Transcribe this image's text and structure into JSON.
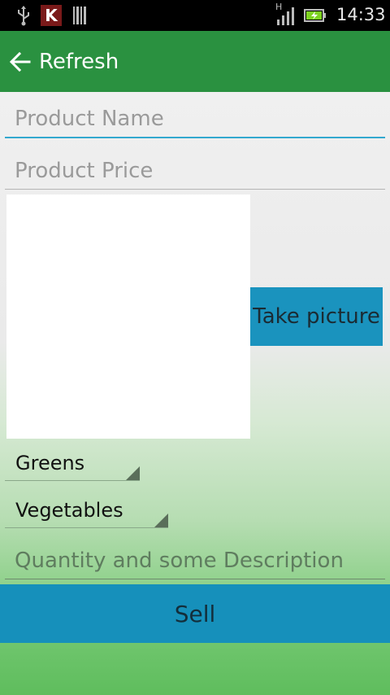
{
  "status_bar": {
    "time": "14:33",
    "network_type": "H",
    "k_app_letter": "K",
    "icons": [
      "usb-icon",
      "k-app-icon",
      "barcode-icon",
      "signal-icon",
      "battery-charging-icon"
    ]
  },
  "action_bar": {
    "title": "Refresh",
    "back_icon": "arrow-left-icon",
    "color": "#2a9140"
  },
  "form": {
    "product_name_placeholder": "Product Name",
    "product_price_placeholder": "Product Price",
    "take_picture_label": "Take picture",
    "category_selected": "Greens",
    "subcategory_selected": "Vegetables",
    "description_placeholder": "Quantity and some Description",
    "sell_label": "Sell"
  },
  "colors": {
    "accent_blue": "#1a93be",
    "input_focus": "#33a8cf"
  }
}
